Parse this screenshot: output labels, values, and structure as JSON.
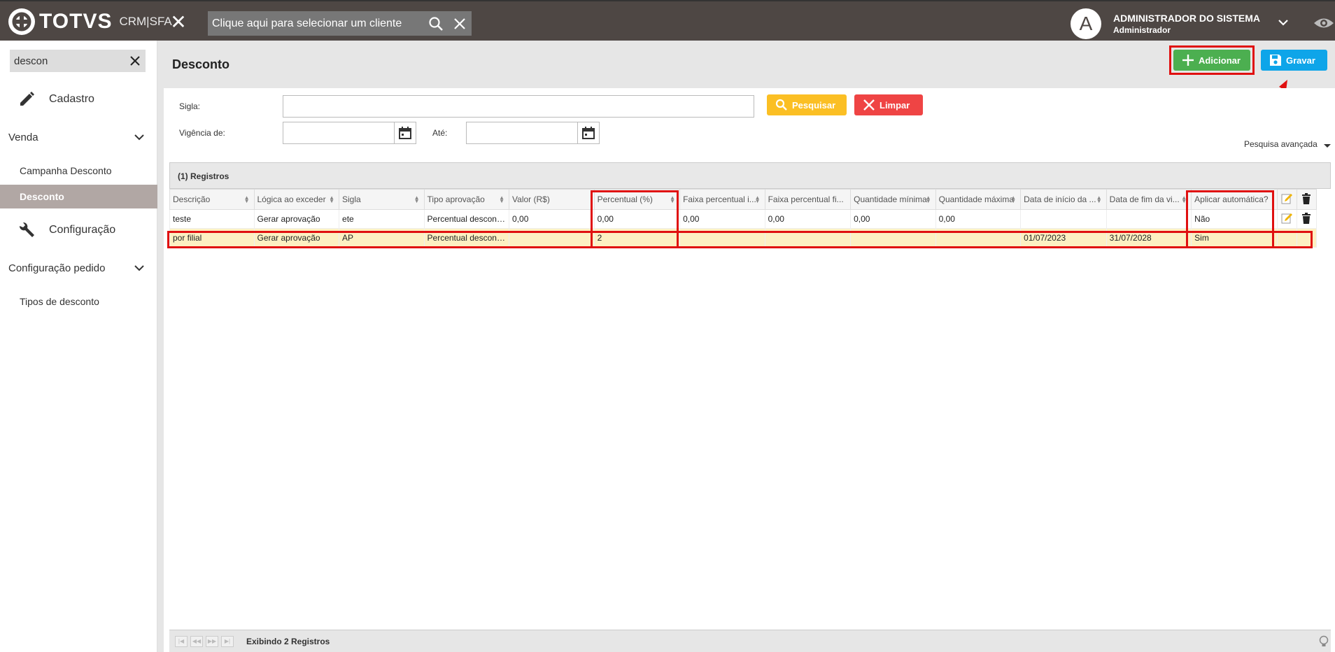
{
  "header": {
    "brand": "TOTVS",
    "brand_sub": "CRM|SFA",
    "client_search_placeholder": "Clique aqui para selecionar um cliente",
    "user_initial": "A",
    "user_name": "ADMINISTRADOR DO SISTEMA",
    "user_role": "Administrador"
  },
  "sidebar": {
    "search_value": "descon",
    "cadastro": "Cadastro",
    "venda": "Venda",
    "venda_items": [
      "Campanha Desconto",
      "Desconto"
    ],
    "configuracao": "Configuração",
    "config_pedido": "Configuração pedido",
    "config_pedido_items": [
      "Tipos de desconto"
    ]
  },
  "page": {
    "title": "Desconto",
    "add_label": "Adicionar",
    "save_label": "Gravar"
  },
  "filters": {
    "sigla_label": "Sigla:",
    "vigencia_label": "Vigência de:",
    "ate_label": "Até:",
    "search_label": "Pesquisar",
    "clear_label": "Limpar",
    "advanced_label": "Pesquisa avançada"
  },
  "grid": {
    "title": "(1) Registros",
    "columns": [
      "Descrição",
      "Lógica ao exceder",
      "Sigla",
      "Tipo aprovação",
      "Valor (R$)",
      "Percentual (%)",
      "Faixa percentual i...",
      "Faixa percentual fi...",
      "Quantidade mínima",
      "Quantidade máxima",
      "Data de início da ...",
      "Data de fim da vi...",
      "Aplicar automática?"
    ],
    "rows": [
      [
        "teste",
        "Gerar aprovação",
        "ete",
        "Percentual descont...",
        "0,00",
        "0,00",
        "0,00",
        "0,00",
        "0,00",
        "0,00",
        "",
        "",
        "Não"
      ],
      [
        "por filial",
        "Gerar aprovação",
        "AP",
        "Percentual descont...",
        "",
        "2",
        "",
        "",
        "",
        "",
        "01/07/2023",
        "31/07/2028",
        "Sim"
      ]
    ],
    "footer_text": "Exibindo 2 Registros"
  },
  "colors": {
    "topbar": "#4e4744",
    "add": "#4caf50",
    "save": "#0ea5e9",
    "search": "#fbbf24",
    "clear": "#ef4444",
    "highlight": "#e01010",
    "selected_row": "#fdf0c2"
  },
  "icons": [
    "close-icon",
    "search-icon",
    "chevron-down-icon",
    "eye-icon",
    "pencil-icon",
    "wrench-icon",
    "plus-icon",
    "floppy-disk-icon",
    "calendar-icon",
    "edit-icon",
    "trash-icon",
    "lightbulb-icon",
    "arrow-annotation"
  ]
}
